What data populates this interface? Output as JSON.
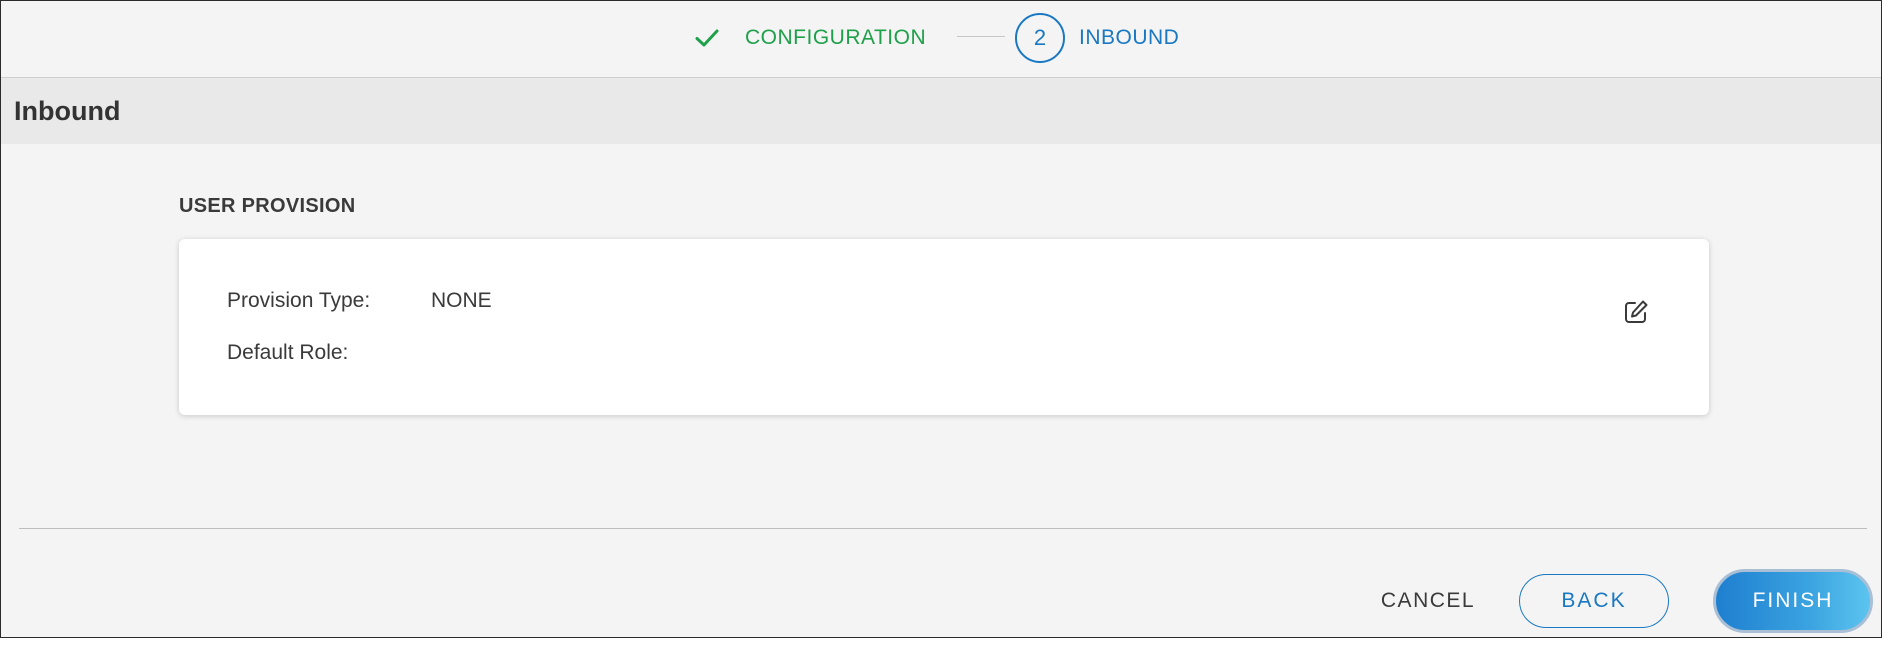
{
  "stepper": {
    "steps": [
      {
        "label": "CONFIGURATION",
        "status": "complete",
        "icon": "check-icon"
      },
      {
        "number": "2",
        "label": "INBOUND",
        "status": "current"
      }
    ]
  },
  "section": {
    "title": "Inbound"
  },
  "user_provision": {
    "title": "USER PROVISION",
    "fields": [
      {
        "label": "Provision Type:",
        "value": "NONE"
      },
      {
        "label": "Default Role:",
        "value": ""
      }
    ],
    "edit_icon": "edit-icon"
  },
  "footer": {
    "cancel_label": "CANCEL",
    "back_label": "BACK",
    "finish_label": "FINISH"
  },
  "colors": {
    "complete": "#1fa04a",
    "accent": "#1a78c2",
    "background": "#f4f4f4",
    "header_band": "#e9e9e9"
  }
}
